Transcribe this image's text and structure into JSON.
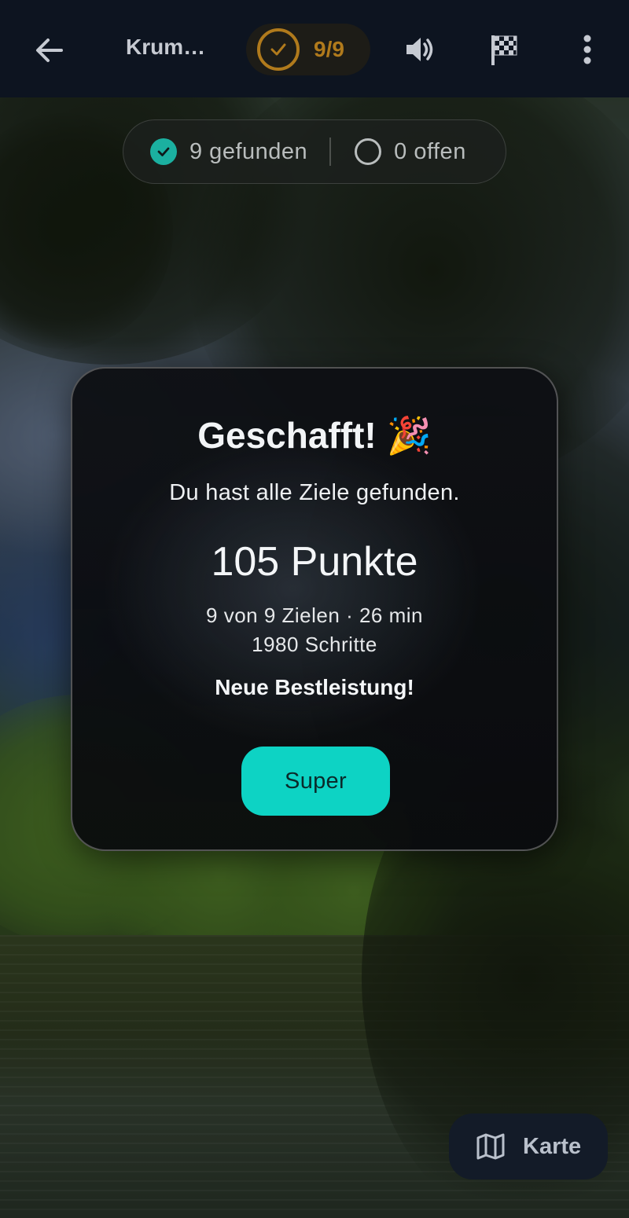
{
  "appbar": {
    "title": "Krum…",
    "progress": "9/9",
    "progress_color": "#b07a1c",
    "icons": [
      "arrow-left-icon",
      "check-icon",
      "volume-icon",
      "checkered-flag-icon",
      "more-vertical-icon"
    ]
  },
  "status": {
    "found_label": "9 gefunden",
    "open_label": "0 offen",
    "found_color": "#1bb0a0"
  },
  "dialog": {
    "headline": "Geschafft! 🎉",
    "subtitle": "Du hast alle Ziele gefunden.",
    "points": "105 Punkte",
    "stats_line1": "9 von 9 Zielen · 26 min",
    "stats_line2": "1980 Schritte",
    "best": "Neue Bestleistung!",
    "button_label": "Super",
    "button_color": "#0dd3c4"
  },
  "fab": {
    "label": "Karte",
    "icon": "map-icon"
  }
}
